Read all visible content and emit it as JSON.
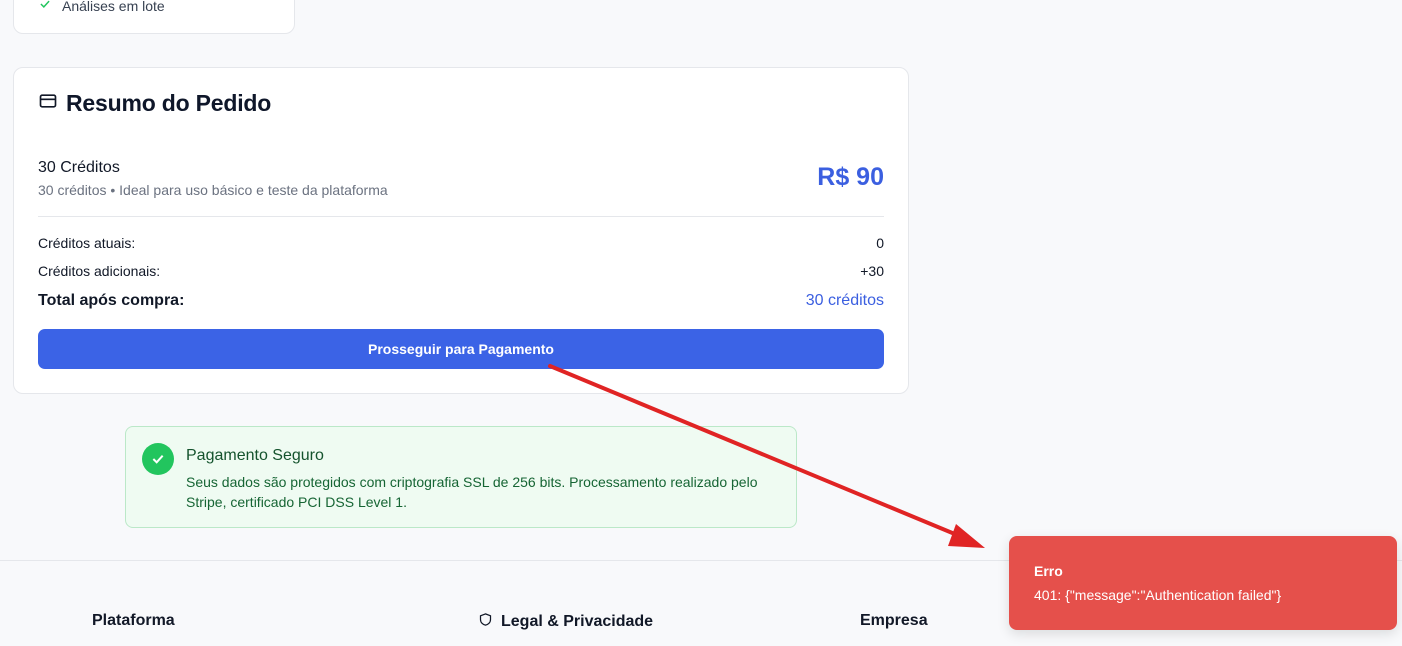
{
  "top_card": {
    "feature": "Análises em lote"
  },
  "summary": {
    "title": "Resumo do Pedido",
    "package_name": "30 Créditos",
    "package_desc": "30 créditos • Ideal para uso básico e teste da plataforma",
    "price": "R$ 90",
    "current_label": "Créditos atuais:",
    "current_value": "0",
    "additional_label": "Créditos adicionais:",
    "additional_value": "+30",
    "total_label": "Total após compra:",
    "total_value": "30 créditos",
    "button_label": "Prosseguir para Pagamento"
  },
  "secure": {
    "title": "Pagamento Seguro",
    "text": "Seus dados são protegidos com criptografia SSL de 256 bits. Processamento realizado pelo Stripe, certificado PCI DSS Level 1."
  },
  "footer": {
    "col1": "Plataforma",
    "col2": "Legal & Privacidade",
    "col3": "Empresa"
  },
  "toast": {
    "title": "Erro",
    "message": "401: {\"message\":\"Authentication failed\"}"
  },
  "colors": {
    "accent": "#3b63e6",
    "success": "#22c55e",
    "error": "#e5504b",
    "annotation_arrow": "#e02424"
  },
  "icons": [
    "check-icon",
    "credit-card-icon",
    "check-circle-icon",
    "shield-icon",
    "arrow-annotation"
  ]
}
